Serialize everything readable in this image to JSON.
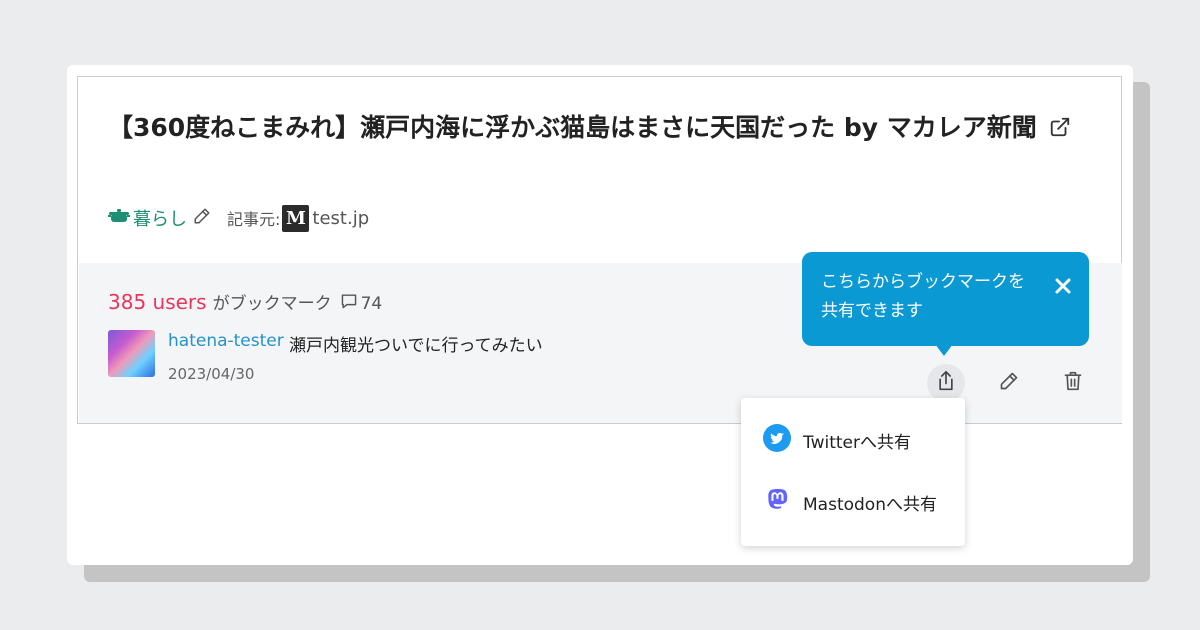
{
  "entry": {
    "title": "【360度ねこまみれ】瀬戸内海に浮かぶ猫島はまさに天国だった by マカレア新聞",
    "category": "暮らし",
    "source_label": "記事元:",
    "source_favicon": "M",
    "source_domain": "test.jp"
  },
  "bookmarks": {
    "users_count": "385 users",
    "users_suffix": "がブックマーク",
    "comment_count": "74"
  },
  "my_bookmark": {
    "username": "hatena-tester",
    "comment": "瀬戸内観光ついでに行ってみたい",
    "date": "2023/04/30"
  },
  "tooltip": {
    "text": "こちらからブックマークを共有できます"
  },
  "share_menu": {
    "twitter_label": "Twitterへ共有",
    "mastodon_label": "Mastodonへ共有"
  },
  "colors": {
    "accent_blue": "#0a99d3",
    "users_red": "#e8375a",
    "category_green": "#1f8f74",
    "twitter_blue": "#1d9bf0",
    "mastodon_purple": "#6364ff"
  },
  "icons": [
    "external-link-icon",
    "category-pot-icon",
    "pencil-icon",
    "comment-icon",
    "share-icon",
    "edit-icon",
    "trash-icon",
    "close-icon",
    "twitter-icon",
    "mastodon-icon"
  ]
}
